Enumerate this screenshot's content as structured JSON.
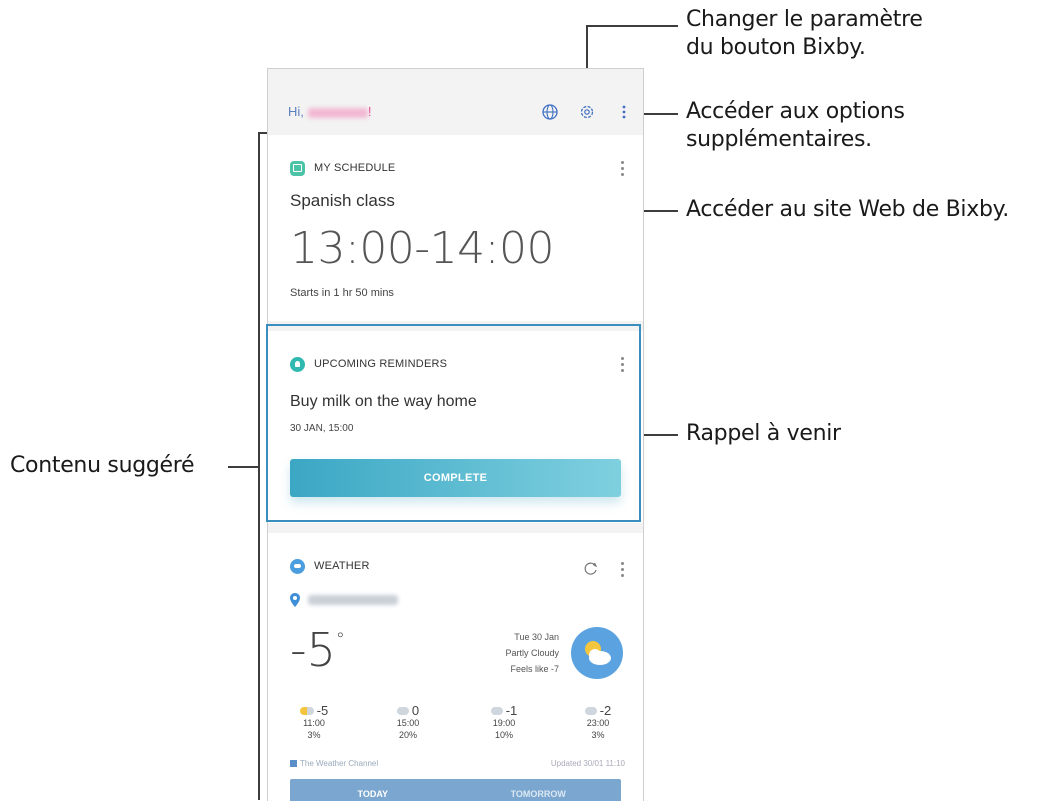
{
  "annotations": {
    "bixby_button": [
      "Changer le paramètre",
      "du bouton Bixby."
    ],
    "more_options": [
      "Accéder aux options",
      "supplémentaires."
    ],
    "bixby_web": "Accéder au site Web de Bixby.",
    "reminder": "Rappel à venir",
    "suggested": "Contenu suggéré"
  },
  "header": {
    "greeting": "Hi,"
  },
  "schedule": {
    "title": "MY SCHEDULE",
    "event": "Spanish class",
    "time": "13:00-14:00",
    "starts": "Starts in 1 hr 50 mins"
  },
  "reminders": {
    "title": "UPCOMING REMINDERS",
    "text": "Buy milk on the way home",
    "date": "30 JAN, 15:00",
    "button": "COMPLETE"
  },
  "weather": {
    "title": "WEATHER",
    "temp": "-5",
    "date": "Tue 30 Jan",
    "condition": "Partly Cloudy",
    "feels": "Feels like -7",
    "hourly": [
      {
        "temp": "-5",
        "time": "11:00",
        "precip": "3%"
      },
      {
        "temp": "0",
        "time": "15:00",
        "precip": "20%"
      },
      {
        "temp": "-1",
        "time": "19:00",
        "precip": "10%"
      },
      {
        "temp": "-2",
        "time": "23:00",
        "precip": "3%"
      }
    ],
    "source": "The Weather Channel",
    "updated": "Updated 30/01 11:10",
    "tabs": [
      "TODAY",
      "TOMORROW"
    ]
  },
  "colors": {
    "accent_teal": "#3ba7c4",
    "callout_box": "#3b8fbf",
    "weather_blue": "#5aa2e0"
  }
}
